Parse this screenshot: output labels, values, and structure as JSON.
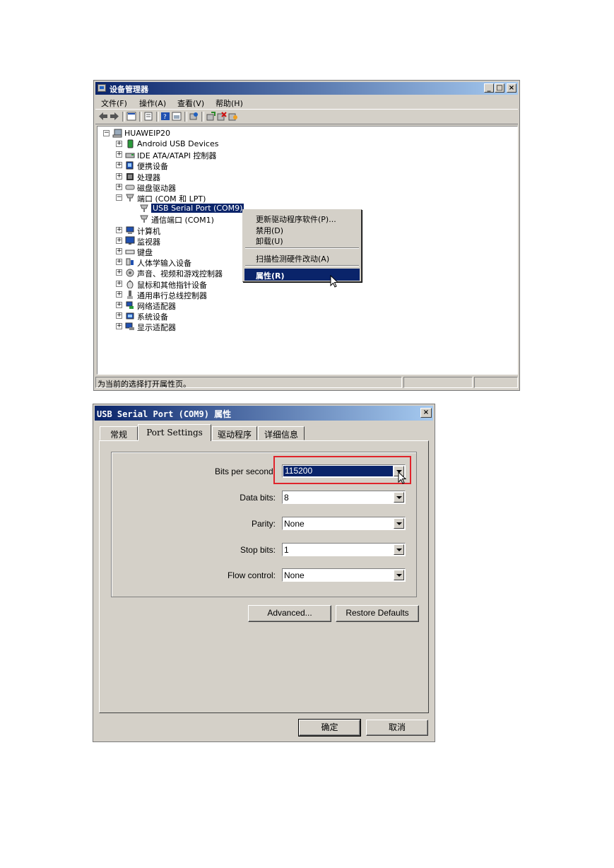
{
  "device_manager": {
    "title": "设备管理器",
    "window_buttons": [
      "_",
      "□",
      "×"
    ],
    "menu": [
      "文件(F)",
      "操作(A)",
      "查看(V)",
      "帮助(H)"
    ],
    "tree_root": "HUAWEIP20",
    "tree": [
      {
        "label": "Android USB Devices",
        "icon": "phone-icon",
        "expander": "+"
      },
      {
        "label": "IDE ATA/ATAPI 控制器",
        "icon": "ide-controller-icon",
        "expander": "+"
      },
      {
        "label": "便携设备",
        "icon": "portable-device-icon",
        "expander": "+"
      },
      {
        "label": "处理器",
        "icon": "processor-icon",
        "expander": "+"
      },
      {
        "label": "磁盘驱动器",
        "icon": "disk-drive-icon",
        "expander": "+"
      },
      {
        "label": "端口 (COM 和 LPT)",
        "icon": "port-icon",
        "expander": "-"
      },
      {
        "label": "USB Serial Port (COM9)",
        "icon": "port-icon",
        "child": true,
        "selected": true
      },
      {
        "label": "通信端口 (COM1)",
        "icon": "port-icon",
        "child": true
      },
      {
        "label": "计算机",
        "icon": "computer-icon",
        "expander": "+"
      },
      {
        "label": "监视器",
        "icon": "monitor-icon",
        "expander": "+"
      },
      {
        "label": "键盘",
        "icon": "keyboard-icon",
        "expander": "+"
      },
      {
        "label": "人体学输入设备",
        "icon": "hid-icon",
        "expander": "+"
      },
      {
        "label": "声音、视频和游戏控制器",
        "icon": "sound-icon",
        "expander": "+"
      },
      {
        "label": "鼠标和其他指针设备",
        "icon": "mouse-icon",
        "expander": "+"
      },
      {
        "label": "通用串行总线控制器",
        "icon": "usb-icon",
        "expander": "+"
      },
      {
        "label": "网络适配器",
        "icon": "network-icon",
        "expander": "+"
      },
      {
        "label": "系统设备",
        "icon": "system-device-icon",
        "expander": "+"
      },
      {
        "label": "显示适配器",
        "icon": "display-adapter-icon",
        "expander": "+"
      }
    ],
    "context_menu": [
      "更新驱动程序软件(P)...",
      "禁用(D)",
      "卸载(U)",
      "扫描检测硬件改动(A)",
      "属性(R)"
    ],
    "status_text": "为当前的选择打开属性页。"
  },
  "properties": {
    "title": "USB Serial Port (COM9) 属性",
    "close": "×",
    "tabs": [
      "常规",
      "Port Settings",
      "驱动程序",
      "详细信息"
    ],
    "active_tab": "Port Settings",
    "fields": [
      {
        "label": "Bits per second:",
        "value": "115200"
      },
      {
        "label": "Data bits:",
        "value": "8"
      },
      {
        "label": "Parity:",
        "value": "None"
      },
      {
        "label": "Stop bits:",
        "value": "1"
      },
      {
        "label": "Flow control:",
        "value": "None"
      }
    ],
    "advanced_label": "Advanced...",
    "restore_label": "Restore Defaults",
    "ok_label": "确定",
    "cancel_label": "取消"
  },
  "colors": {
    "title_bar": "#0a246a",
    "selection": "#0a246a",
    "window_face": "#d4d0c8",
    "highlight_box": "#e0242b"
  }
}
